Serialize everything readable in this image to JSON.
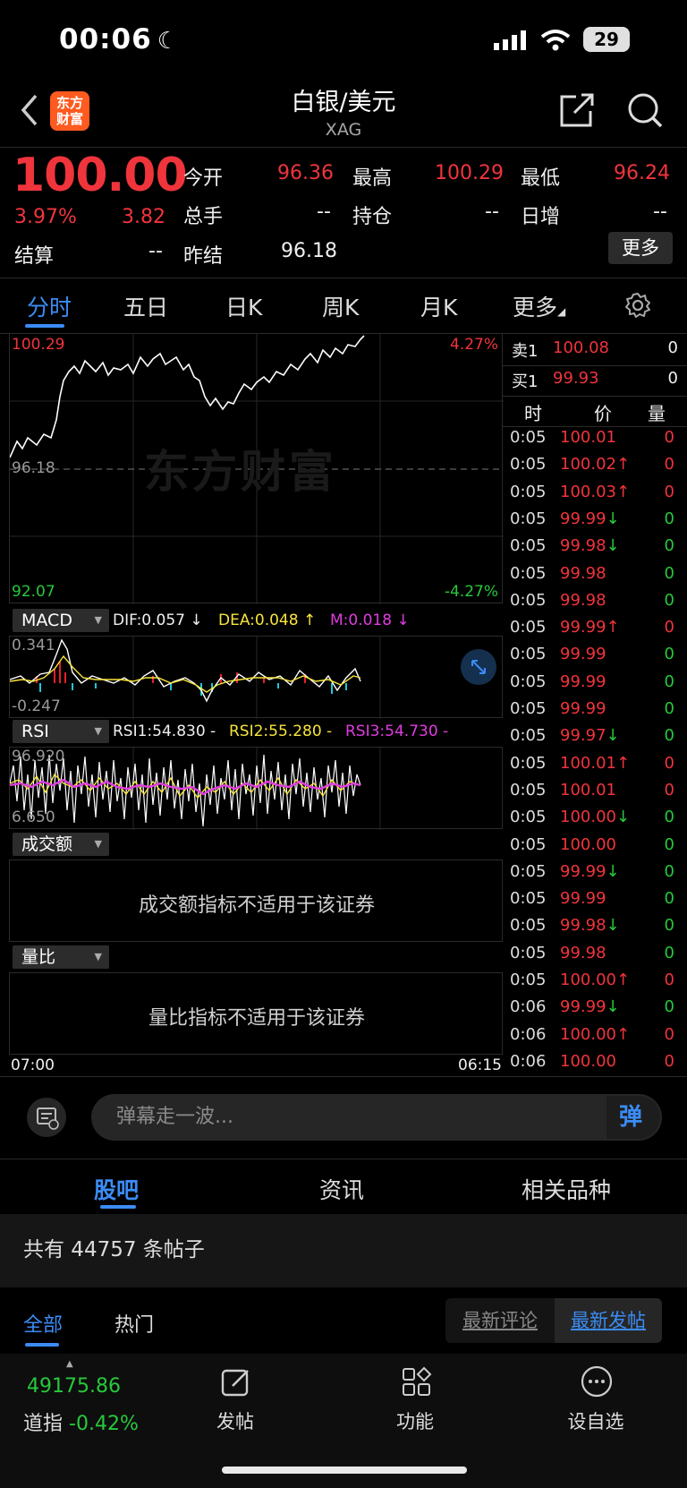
{
  "status": {
    "time": "00:06",
    "battery": "29"
  },
  "header": {
    "title": "白银/美元",
    "subtitle": "XAG",
    "logo_text_1": "东方",
    "logo_text_2": "财富"
  },
  "quote": {
    "price": "100.00",
    "change_pct": "3.97%",
    "change": "3.82",
    "open_label": "今开",
    "open": "96.36",
    "high_label": "最高",
    "high": "100.29",
    "low_label": "最低",
    "low": "96.24",
    "volume_label": "总手",
    "volume": "--",
    "position_label": "持仓",
    "position": "--",
    "daily_inc_label": "日增",
    "daily_inc": "--",
    "settle_label": "结算",
    "settle": "--",
    "prev_settle_label": "昨结",
    "prev_settle": "96.18",
    "more_label": "更多"
  },
  "tabs": [
    "分时",
    "五日",
    "日K",
    "周K",
    "月K",
    "更多"
  ],
  "chart": {
    "max_price": "100.29",
    "min_price": "92.07",
    "ref_price": "96.18",
    "max_pct": "4.27%",
    "min_pct": "-4.27%",
    "watermark": "东方财富",
    "time_start": "07:00",
    "time_end": "06:15"
  },
  "macd": {
    "name": "MACD",
    "dif": "DIF:0.057 ↓",
    "dea": "DEA:0.048 ↑",
    "m": "M:0.018 ↓",
    "top": "0.341",
    "bottom": "-0.247"
  },
  "rsi": {
    "name": "RSI",
    "rsi1": "RSI1:54.830 -",
    "rsi2": "RSI2:55.280 -",
    "rsi3": "RSI3:54.730 -",
    "top": "96.920",
    "bottom": "6.650"
  },
  "turnover": {
    "name": "成交额",
    "message": "成交额指标不适用于该证券"
  },
  "volratio": {
    "name": "量比",
    "message": "量比指标不适用于该证券"
  },
  "orderbook": {
    "sell_label": "卖1",
    "sell_price": "100.08",
    "sell_vol": "0",
    "buy_label": "买1",
    "buy_price": "99.93",
    "buy_vol": "0",
    "col_time": "时",
    "col_price": "价",
    "col_vol": "量"
  },
  "trades": [
    {
      "t": "0:05",
      "p": "100.01",
      "a": "",
      "v": "0",
      "c": "red",
      "vc": "red"
    },
    {
      "t": "0:05",
      "p": "100.02",
      "a": "↑",
      "v": "0",
      "c": "red",
      "vc": "red"
    },
    {
      "t": "0:05",
      "p": "100.03",
      "a": "↑",
      "v": "0",
      "c": "red",
      "vc": "red"
    },
    {
      "t": "0:05",
      "p": "99.99",
      "a": "↓",
      "v": "0",
      "c": "red",
      "vc": "green"
    },
    {
      "t": "0:05",
      "p": "99.98",
      "a": "↓",
      "v": "0",
      "c": "red",
      "vc": "green"
    },
    {
      "t": "0:05",
      "p": "99.98",
      "a": "",
      "v": "0",
      "c": "red",
      "vc": "green"
    },
    {
      "t": "0:05",
      "p": "99.98",
      "a": "",
      "v": "0",
      "c": "red",
      "vc": "green"
    },
    {
      "t": "0:05",
      "p": "99.99",
      "a": "↑",
      "v": "0",
      "c": "red",
      "vc": "red"
    },
    {
      "t": "0:05",
      "p": "99.99",
      "a": "",
      "v": "0",
      "c": "red",
      "vc": "green"
    },
    {
      "t": "0:05",
      "p": "99.99",
      "a": "",
      "v": "0",
      "c": "red",
      "vc": "green"
    },
    {
      "t": "0:05",
      "p": "99.99",
      "a": "",
      "v": "0",
      "c": "red",
      "vc": "green"
    },
    {
      "t": "0:05",
      "p": "99.97",
      "a": "↓",
      "v": "0",
      "c": "red",
      "vc": "green"
    },
    {
      "t": "0:05",
      "p": "100.01",
      "a": "↑",
      "v": "0",
      "c": "red",
      "vc": "red"
    },
    {
      "t": "0:05",
      "p": "100.01",
      "a": "",
      "v": "0",
      "c": "red",
      "vc": "red"
    },
    {
      "t": "0:05",
      "p": "100.00",
      "a": "↓",
      "v": "0",
      "c": "red",
      "vc": "green"
    },
    {
      "t": "0:05",
      "p": "100.00",
      "a": "",
      "v": "0",
      "c": "red",
      "vc": "green"
    },
    {
      "t": "0:05",
      "p": "99.99",
      "a": "↓",
      "v": "0",
      "c": "red",
      "vc": "green"
    },
    {
      "t": "0:05",
      "p": "99.99",
      "a": "",
      "v": "0",
      "c": "red",
      "vc": "green"
    },
    {
      "t": "0:05",
      "p": "99.98",
      "a": "↓",
      "v": "0",
      "c": "red",
      "vc": "green"
    },
    {
      "t": "0:05",
      "p": "99.98",
      "a": "",
      "v": "0",
      "c": "red",
      "vc": "green"
    },
    {
      "t": "0:05",
      "p": "100.00",
      "a": "↑",
      "v": "0",
      "c": "red",
      "vc": "red"
    },
    {
      "t": "0:06",
      "p": "99.99",
      "a": "↓",
      "v": "0",
      "c": "red",
      "vc": "green"
    },
    {
      "t": "0:06",
      "p": "100.00",
      "a": "↑",
      "v": "0",
      "c": "red",
      "vc": "red"
    },
    {
      "t": "0:06",
      "p": "100.00",
      "a": "",
      "v": "0",
      "c": "red",
      "vc": "red"
    }
  ],
  "danmaku": {
    "placeholder": "弹幕走一波...",
    "btn": "弹"
  },
  "sections": [
    "股吧",
    "资讯",
    "相关品种"
  ],
  "post_count": "共有 44757 条帖子",
  "filters": {
    "all": "全部",
    "hot": "热门",
    "latest_comment": "最新评论",
    "latest_post": "最新发帖"
  },
  "bottom": {
    "index_value": "49175.86",
    "index_name": "道指",
    "index_pct": "-0.42%",
    "post": "发帖",
    "func": "功能",
    "watch": "设自选"
  },
  "colors": {
    "up": "#f0343c",
    "down": "#27c93b",
    "accent": "#3b8cf5"
  }
}
